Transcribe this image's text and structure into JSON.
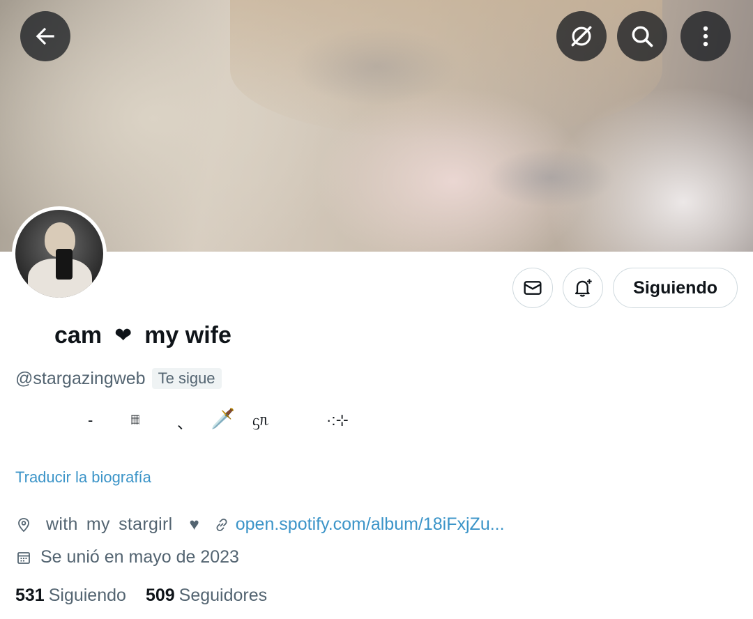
{
  "header": {
    "back_icon": "arrow-left-icon",
    "grok_icon": "grok-icon",
    "search_icon": "search-icon",
    "more_icon": "more-vertical-icon"
  },
  "profile": {
    "display_name_part1": "cam",
    "display_name_heart": "❤",
    "display_name_part2": "my wife",
    "handle": "@stargazingweb",
    "follows_you_badge": "Te sigue",
    "bio_glyphs": [
      "-",
      "𝄜",
      "、",
      "🗡️",
      "ᦓᥰ",
      "·:⊹"
    ],
    "translate_label": "Traducir la biografía",
    "location": "with my stargirl",
    "location_heart": "♥",
    "website": "open.spotify.com/album/18iFxjZu...",
    "joined": "Se unió en mayo de 2023",
    "following_count": "531",
    "following_label": "Siguiendo",
    "followers_count": "509",
    "followers_label": "Seguidores"
  },
  "actions": {
    "message_icon": "mail-icon",
    "notify_icon": "bell-plus-icon",
    "following_button_label": "Siguiendo"
  },
  "colors": {
    "text_primary": "#0f1419",
    "text_secondary": "#536471",
    "link": "#3b94c8",
    "border": "#cfd9de"
  }
}
